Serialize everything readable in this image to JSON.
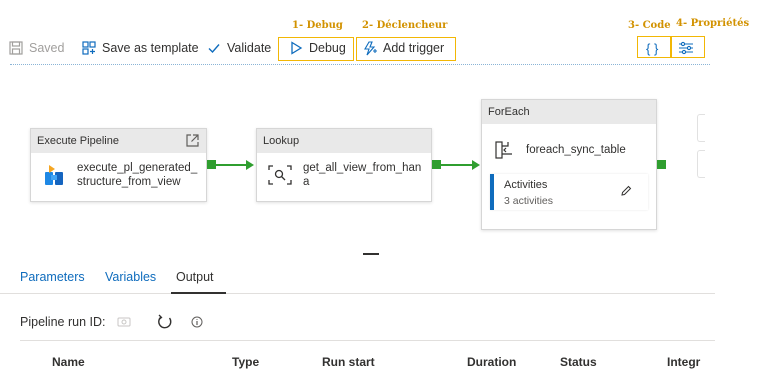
{
  "annotations": {
    "debug": "1- Debug",
    "trigger": "2- Déclencheur",
    "code": "3- Code",
    "properties": "4- Propriétés"
  },
  "toolbar": {
    "saved_label": "Saved",
    "save_template_label": "Save as template",
    "validate_label": "Validate",
    "debug_label": "Debug",
    "add_trigger_label": "Add trigger"
  },
  "nodes": {
    "execute_pipeline": {
      "header": "Execute Pipeline",
      "name_line1": "execute_pl_generated_",
      "name_line2": "structure_from_view"
    },
    "lookup": {
      "header": "Lookup",
      "name_line1": "get_all_view_from_han",
      "name_line2": "a"
    },
    "foreach": {
      "header": "ForEach",
      "name": "foreach_sync_table",
      "activities_title": "Activities",
      "activities_count": "3 activities"
    }
  },
  "tabs": [
    {
      "label": "Parameters",
      "active": false
    },
    {
      "label": "Variables",
      "active": false
    },
    {
      "label": "Output",
      "active": true
    }
  ],
  "output": {
    "run_id_label": "Pipeline run ID:",
    "columns": [
      "Name",
      "Type",
      "Run start",
      "Duration",
      "Status",
      "Integr"
    ]
  },
  "colors": {
    "accent": "#0f6cbd",
    "success": "#2f9e2f",
    "annotation": "#d29200"
  }
}
